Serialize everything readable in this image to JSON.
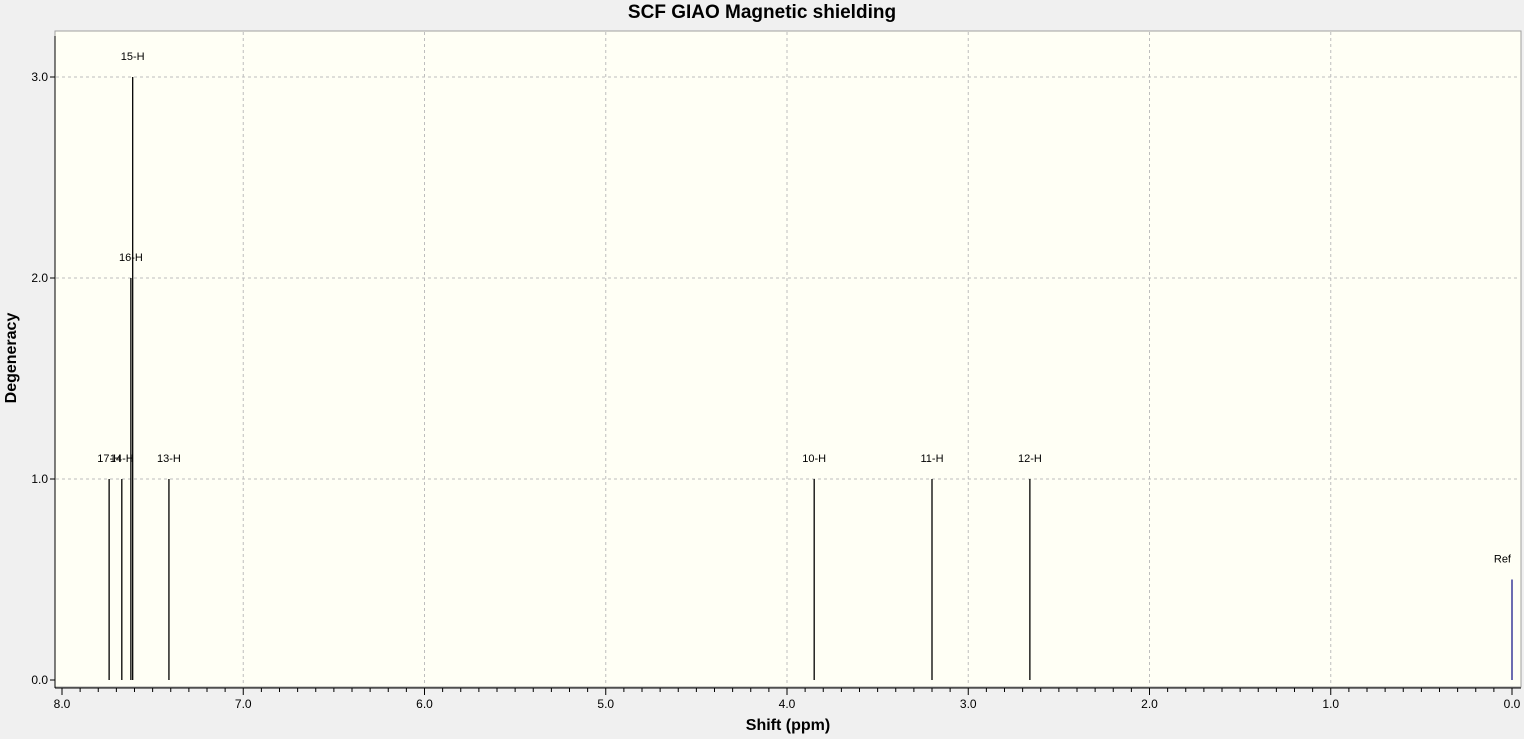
{
  "chart_data": {
    "type": "bar",
    "title": "SCF GIAO Magnetic shielding",
    "xlabel": "Shift (ppm)",
    "ylabel": "Degeneracy",
    "xlim": [
      8.0,
      0.0
    ],
    "ylim": [
      0.0,
      3.2
    ],
    "x_reversed": true,
    "grid": true,
    "x_ticks": [
      "8.0",
      "7.0",
      "6.0",
      "5.0",
      "4.0",
      "3.0",
      "2.0",
      "1.0",
      "0.0"
    ],
    "y_ticks": [
      "0.0",
      "1.0",
      "2.0",
      "3.0"
    ],
    "peaks": [
      {
        "label": "17-H",
        "x": 7.74,
        "y": 1
      },
      {
        "label": "14-H",
        "x": 7.67,
        "y": 1
      },
      {
        "label": "16-H",
        "x": 7.62,
        "y": 2
      },
      {
        "label": "15-H",
        "x": 7.61,
        "y": 3
      },
      {
        "label": "13-H",
        "x": 7.41,
        "y": 1
      },
      {
        "label": "10-H",
        "x": 3.85,
        "y": 1
      },
      {
        "label": "11-H",
        "x": 3.2,
        "y": 1
      },
      {
        "label": "12-H",
        "x": 2.66,
        "y": 1
      },
      {
        "label": "Ref",
        "x": 0.0,
        "y": 0.5
      }
    ],
    "colors": {
      "plot_bg": "#fffff5",
      "peak": "#000000",
      "ref_peak": "#1c1c8c",
      "grid": "#bdbdbd"
    }
  }
}
